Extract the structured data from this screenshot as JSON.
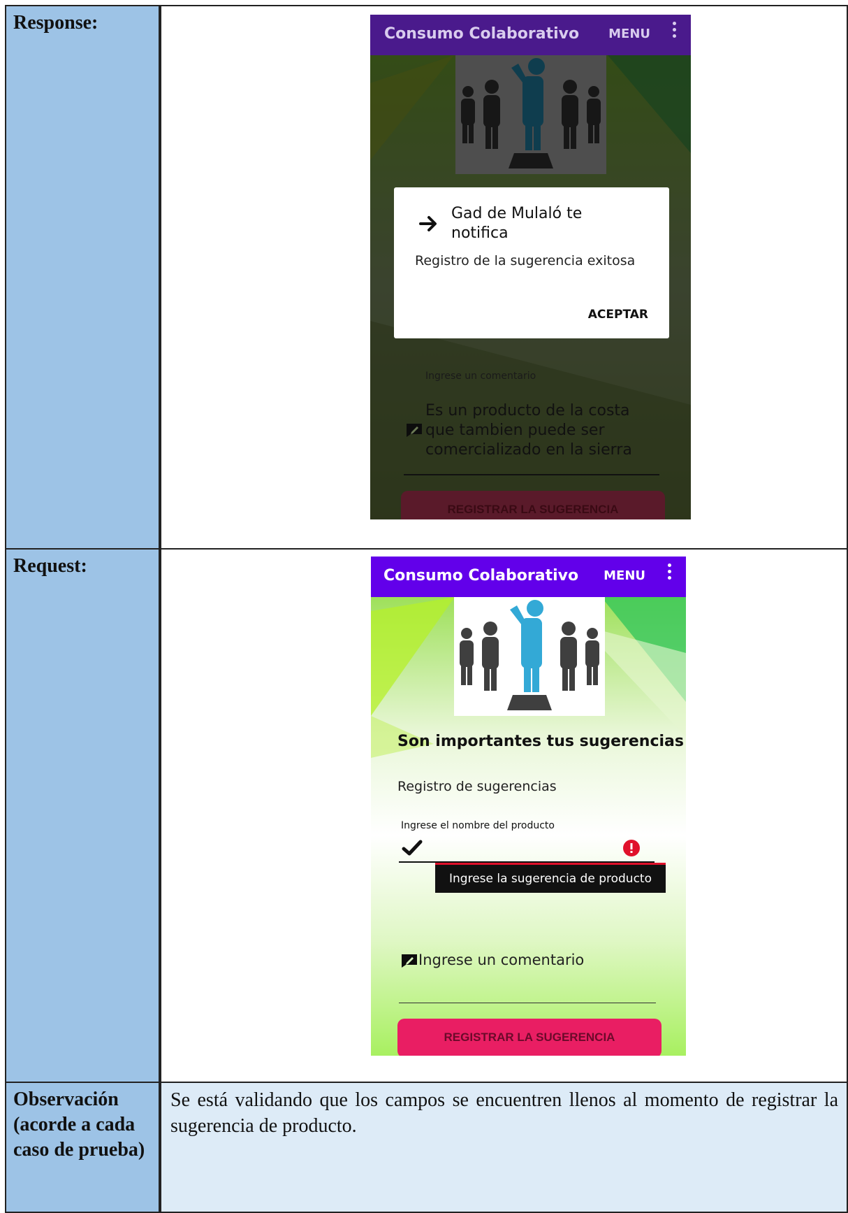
{
  "rows": {
    "response_label": "Response:",
    "request_label": "Request:",
    "observation_label": "Observación (acorde a cada caso de prueba)",
    "observation_text": "Se está validando que los campos se encuentren llenos al momento de registrar la sugerencia de producto."
  },
  "response_screen": {
    "appbar_title": "Consumo Colaborativo",
    "menu_label": "MENU",
    "dialog_title": "Gad de Mulaló te notifica",
    "dialog_message": "Registro de la sugerencia exitosa",
    "dialog_button": "ACEPTAR",
    "comment_label": "Ingrese un comentario",
    "comment_value": "Es un producto de la costa que tambien puede ser comercializado en la sierra",
    "submit_button": "REGISTRAR LA SUGERENCIA"
  },
  "request_screen": {
    "appbar_title": "Consumo Colaborativo",
    "menu_label": "MENU",
    "heading": "Son importantes tus sugerencias",
    "subheading": "Registro de  sugerencias",
    "product_label": "Ingrese el nombre del producto",
    "error_tooltip": "Ingrese la sugerencia de producto",
    "comment_placeholder": "Ingrese un comentario",
    "submit_button": "REGISTRAR LA SUGERENCIA"
  },
  "colors": {
    "label_cell": "#9dc3e6",
    "observation_cell": "#ddebf7",
    "appbar": "#6200ea",
    "button": "#e91e63",
    "error": "#e0112b",
    "figure_main": "#33a9d6",
    "figure_side": "#3f3f3f"
  }
}
